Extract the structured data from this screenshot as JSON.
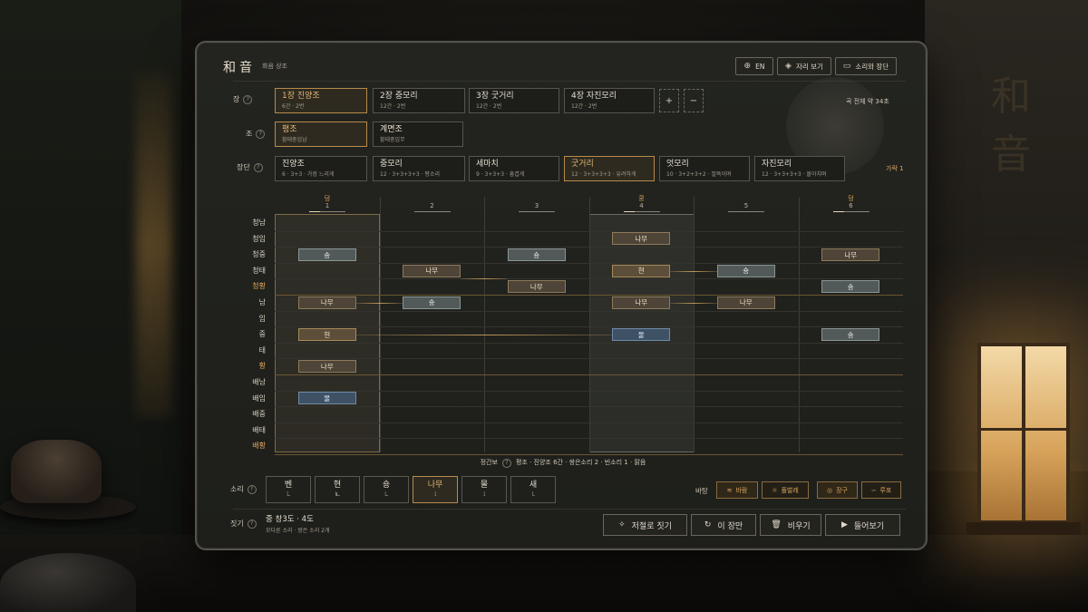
{
  "app": {
    "brand": "和音",
    "subtitle": "화음 상조"
  },
  "scene": {
    "wall_text": "和音"
  },
  "top_buttons": [
    {
      "icon": "globe-icon",
      "label": "EN"
    },
    {
      "icon": "compass-icon",
      "label": "자리 보기"
    },
    {
      "icon": "book-icon",
      "label": "소리와 장단"
    }
  ],
  "jang": {
    "label": "장",
    "items": [
      {
        "title": "1장 진양조",
        "sub": "6간 · 2번",
        "selected": true
      },
      {
        "title": "2장 중모리",
        "sub": "12간 · 2번"
      },
      {
        "title": "3장 굿거리",
        "sub": "12간 · 2번"
      },
      {
        "title": "4장 자진모리",
        "sub": "12간 · 2번"
      }
    ],
    "add": "+",
    "remove": "−",
    "total": "곡 전체 약 34초"
  },
  "jo": {
    "label": "조",
    "items": [
      {
        "title": "평조",
        "sub": "황태중임남",
        "selected": true
      },
      {
        "title": "계면조",
        "sub": "황태중임무"
      }
    ]
  },
  "jangdan": {
    "label": "장단",
    "items": [
      {
        "title": "진양조",
        "sub": "6 · 3+3 · 가장 느리게"
      },
      {
        "title": "중모리",
        "sub": "12 · 3+3+3+3 · 평소리"
      },
      {
        "title": "세마치",
        "sub": "9 · 3+3+3 · 흥겹게"
      },
      {
        "title": "굿거리",
        "sub": "12 · 3+3+3+3 · 유려하게",
        "selected": true
      },
      {
        "title": "엇모리",
        "sub": "10 · 3+2+3+2 · 절뚝이며"
      },
      {
        "title": "자진모리",
        "sub": "12 · 3+3+3+3 · 몰아치며"
      }
    ],
    "garak": "가락 1"
  },
  "columns": [
    {
      "accent": "덩",
      "num": "1"
    },
    {
      "accent": "",
      "num": "2"
    },
    {
      "accent": "",
      "num": "3"
    },
    {
      "accent": "쿵",
      "num": "4"
    },
    {
      "accent": "",
      "num": "5"
    },
    {
      "accent": "덩",
      "num": "6"
    }
  ],
  "pitches": [
    "청남",
    "청임",
    "청중",
    "청태",
    "청황",
    "남",
    "임",
    "중",
    "태",
    "황",
    "배남",
    "배임",
    "배중",
    "배태",
    "배황"
  ],
  "notes": [
    {
      "col": 0,
      "row": 2,
      "type": "song",
      "label": "숑"
    },
    {
      "col": 0,
      "row": 5,
      "type": "namu",
      "label": "나무"
    },
    {
      "col": 0,
      "row": 7,
      "type": "hyeon",
      "label": "현"
    },
    {
      "col": 0,
      "row": 9,
      "type": "namu",
      "label": "나무"
    },
    {
      "col": 0,
      "row": 11,
      "type": "mul",
      "label": "물"
    },
    {
      "col": 1,
      "row": 3,
      "type": "namu",
      "label": "나무"
    },
    {
      "col": 1,
      "row": 5,
      "type": "song",
      "label": "숑"
    },
    {
      "col": 2,
      "row": 2,
      "type": "song",
      "label": "숑"
    },
    {
      "col": 2,
      "row": 4,
      "type": "namu",
      "label": "나무"
    },
    {
      "col": 3,
      "row": 1,
      "type": "namu",
      "label": "나무"
    },
    {
      "col": 3,
      "row": 3,
      "type": "hyeon",
      "label": "현"
    },
    {
      "col": 3,
      "row": 5,
      "type": "namu",
      "label": "나무"
    },
    {
      "col": 3,
      "row": 7,
      "type": "mul",
      "label": "물"
    },
    {
      "col": 4,
      "row": 3,
      "type": "song",
      "label": "숑"
    },
    {
      "col": 4,
      "row": 5,
      "type": "namu",
      "label": "나무"
    },
    {
      "col": 5,
      "row": 2,
      "type": "namu",
      "label": "나무"
    },
    {
      "col": 5,
      "row": 4,
      "type": "song",
      "label": "숑"
    },
    {
      "col": 5,
      "row": 7,
      "type": "song",
      "label": "숑"
    }
  ],
  "caption": {
    "label": "정간보",
    "text": "평조 · 진양조 6간 · 쌍은소리 2 · 빈소리 1 · 맑음"
  },
  "sound": {
    "label": "소리",
    "items": [
      {
        "title": "벤",
        "sub": "l..."
      },
      {
        "title": "현",
        "sub": "lıı..."
      },
      {
        "title": "숑",
        "sub": "l..."
      },
      {
        "title": "나무",
        "sub": "l.",
        "selected": true
      },
      {
        "title": "물",
        "sub": "l."
      },
      {
        "title": "새",
        "sub": "l.."
      }
    ]
  },
  "background": {
    "label": "바탕",
    "items": [
      {
        "icon": "wind-icon",
        "label": "바람",
        "selected": true
      },
      {
        "icon": "bug-icon",
        "label": "풀벌레"
      },
      {
        "icon": "drum-icon",
        "label": "장구",
        "selected": true
      },
      {
        "icon": "wave-icon",
        "label": "루포"
      }
    ]
  },
  "find": {
    "label": "짓기",
    "value": "중 창3도 · 4도",
    "sub": "모다른 소리 · 쌍은 소리 2개"
  },
  "actions": [
    {
      "icon": "sparkle-icon",
      "label": "저절로 짓기"
    },
    {
      "icon": "refresh-icon",
      "label": "이 장만"
    },
    {
      "icon": "trash-icon",
      "label": "비우기"
    },
    {
      "icon": "play-icon",
      "label": "들어보기"
    }
  ]
}
